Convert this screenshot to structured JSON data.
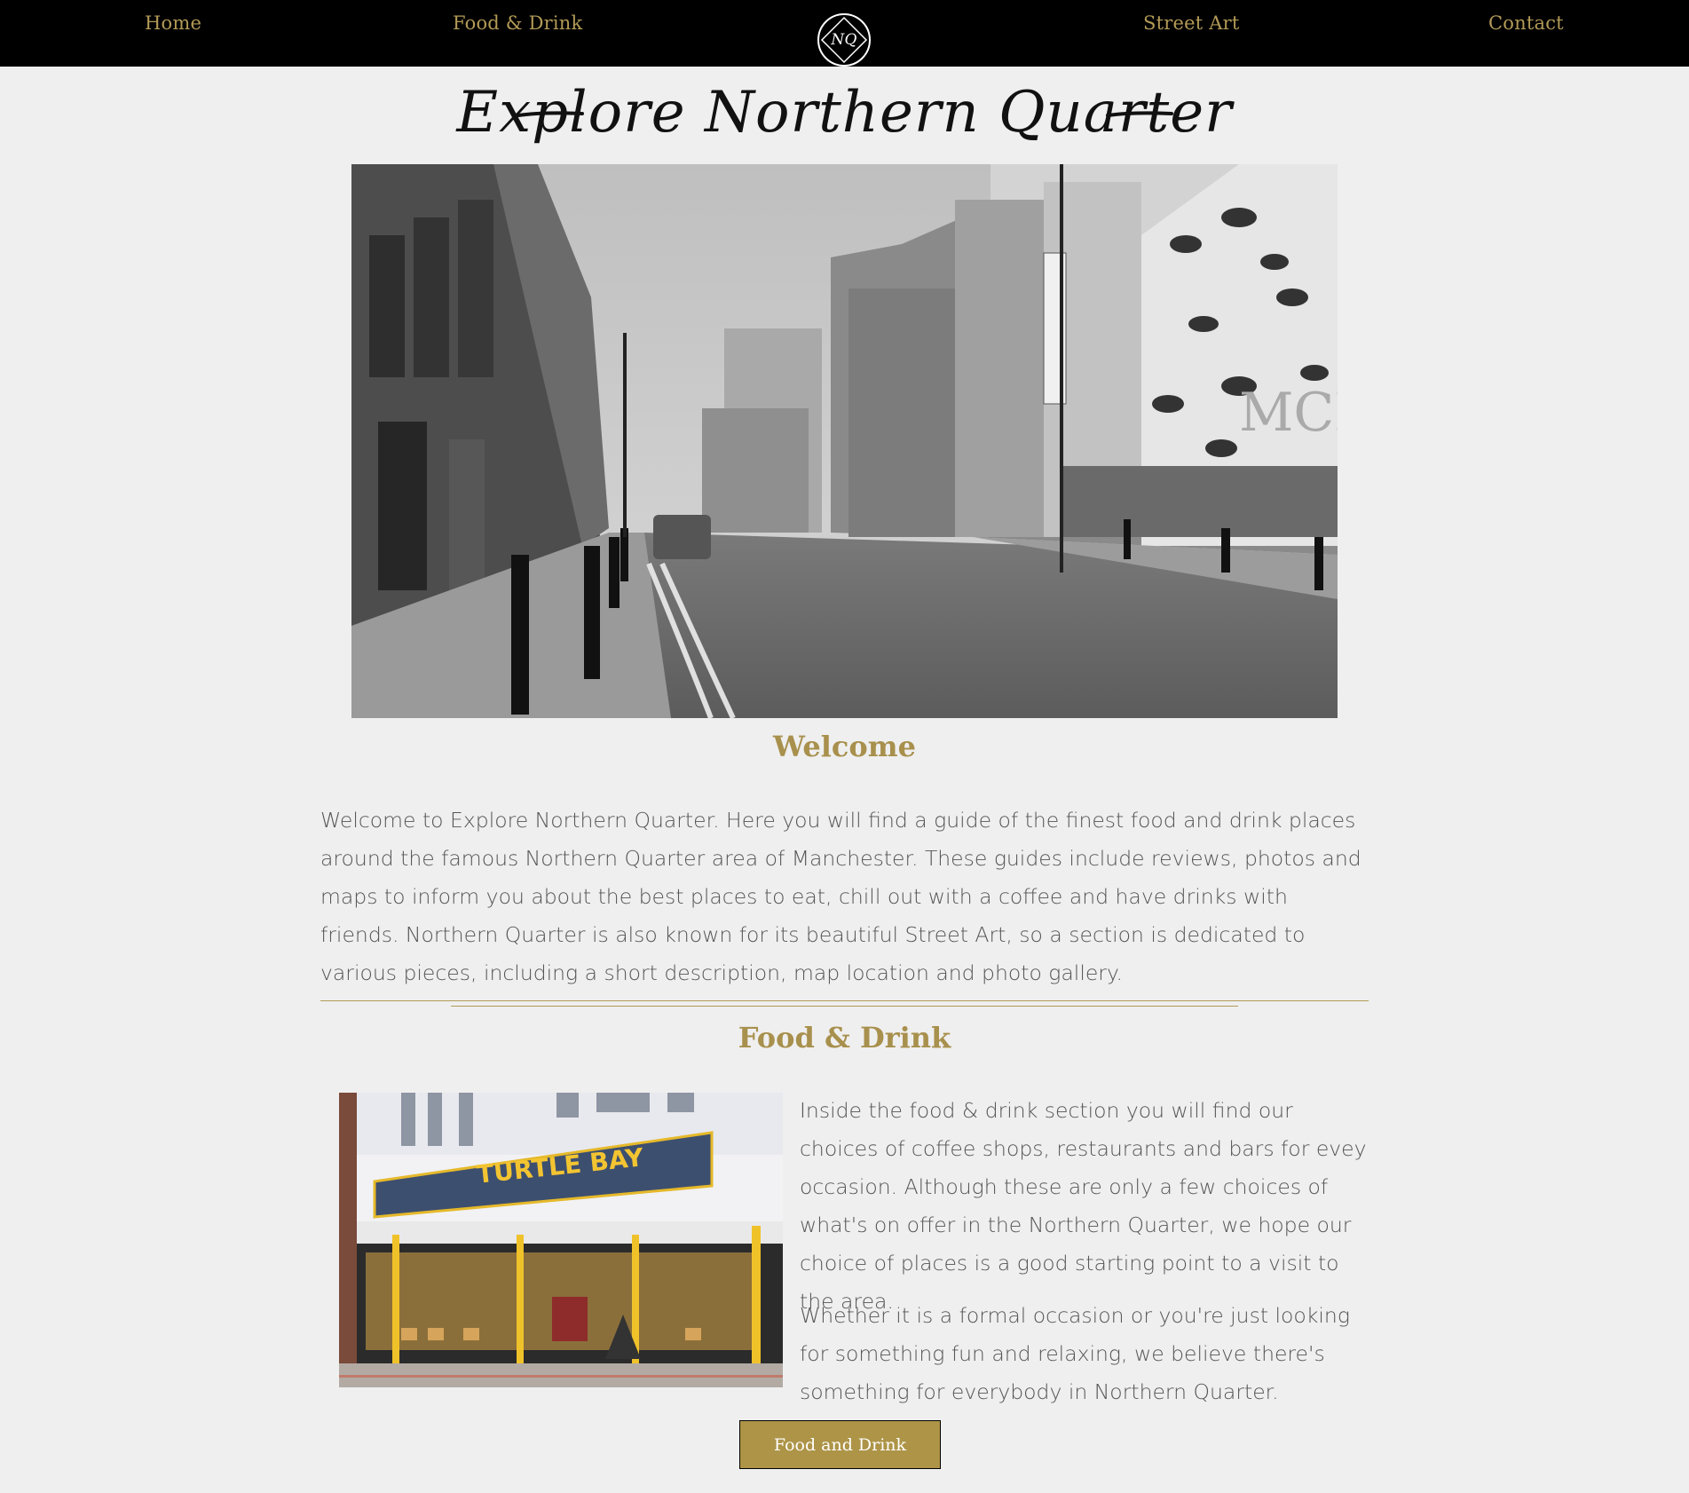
{
  "nav": {
    "home": "Home",
    "food": "Food & Drink",
    "logo": "NQ",
    "street_art": "Street Art",
    "contact": "Contact"
  },
  "hero": {
    "title": "Explore Northern Quarter",
    "image_alt": "Black and white street view of Northern Quarter with bee mural"
  },
  "welcome": {
    "heading": "Welcome",
    "text": "Welcome to Explore Northern Quarter. Here you will find a guide of the finest food and drink places around the famous Northern Quarter area of Manchester. These guides include reviews, photos and maps to inform you about the best places to eat, chill out with a coffee and have drinks with friends. Northern Quarter is also known for its beautiful Street Art, so a section is dedicated to various pieces, including a short description, map location and photo gallery."
  },
  "food": {
    "heading": "Food & Drink",
    "image_alt": "Turtle Bay restaurant exterior",
    "sign": "TURTLE BAY",
    "para1": "Inside the food & drink section you will find our choices of coffee shops, restaurants and bars for evey occasion. Although these are only a few choices of what's on offer in the Northern Quarter, we hope our choice of places is a good starting point to a visit to the area.",
    "para2": "Whether it is a formal occasion or you're just looking for something fun and relaxing, we believe there's something for everybody in Northern Quarter.",
    "button": "Food and Drink"
  },
  "colors": {
    "nav_bg": "#000000",
    "accent": "#b29a56",
    "button_bg": "#ad9447",
    "page_bg": "#efefef",
    "body_text": "#555555"
  }
}
